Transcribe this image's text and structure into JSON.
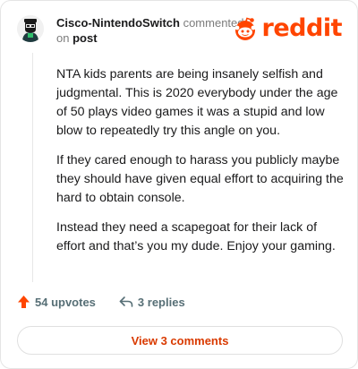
{
  "comment": {
    "author": "Cisco-NintendoSwitch",
    "action_text": "commented",
    "on_text": "on",
    "post_link": "post",
    "paragraphs": [
      "NTA kids parents are being insanely selfish and judgmental. This is 2020 everybody under the age of 50 plays video games it was a stupid and low blow to repeatedly try this angle on you.",
      "If they cared enough to harass you publicly maybe they should have given equal effort to acquiring the hard to obtain console.",
      "Instead they need a scapegoat for their lack of effort and that’s you my dude. Enjoy your gaming."
    ]
  },
  "brand": {
    "logo_text": "reddit",
    "accent_color": "#ff4500"
  },
  "actions": {
    "upvotes_label": "54 upvotes",
    "replies_label": "3 replies",
    "upvote_color": "#ff4500"
  },
  "footer": {
    "view_comments_label": "View 3 comments"
  },
  "icons": {
    "avatar": "avatar-icon",
    "logo": "reddit-alien-icon",
    "upvote": "upvote-arrow-icon",
    "reply": "reply-arrow-icon"
  }
}
